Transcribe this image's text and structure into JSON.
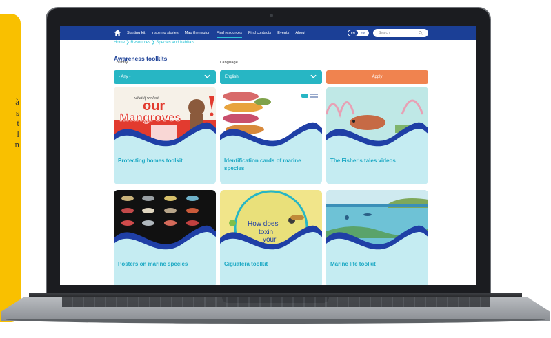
{
  "side_panel": {
    "lines": [
      "à",
      "s",
      "t",
      "l",
      "n"
    ]
  },
  "nav": {
    "items": [
      "Starting kit",
      "Inspiring stories",
      "Map the region",
      "Find resources",
      "Find contacts",
      "Events",
      "About"
    ],
    "active_index": 3,
    "lang_en": "EN",
    "lang_fr": "FR",
    "search_placeholder": "Search"
  },
  "breadcrumb": "Home  ❯  Resources  ❯  Species and habitats",
  "page": {
    "title": "Awareness toolkits",
    "country_label": "Country",
    "language_label": "Language",
    "country_value": "- Any -",
    "language_value": "English",
    "apply_label": "Apply"
  },
  "cards": [
    {
      "title": "Protecting homes toolkit",
      "poster_kicker": "what if we lost",
      "poster_line1": "our",
      "poster_line2": "Mangroves"
    },
    {
      "title": "Identification cards of marine species"
    },
    {
      "title": "The Fisher's tales videos"
    },
    {
      "title": "Posters on marine species"
    },
    {
      "title": "Ciguatera toolkit",
      "poster_line1": "How does",
      "poster_line2": "toxin",
      "poster_line3": "your"
    },
    {
      "title": "Marine life toolkit"
    }
  ],
  "colors": {
    "nav_bg": "#1b3f96",
    "teal": "#27b6c4",
    "apply": "#f0834f",
    "card_bg": "#c5ecf2",
    "card_title": "#1da9c4",
    "wave_dark": "#1f3fa6",
    "panel_yellow": "#f9c000"
  }
}
